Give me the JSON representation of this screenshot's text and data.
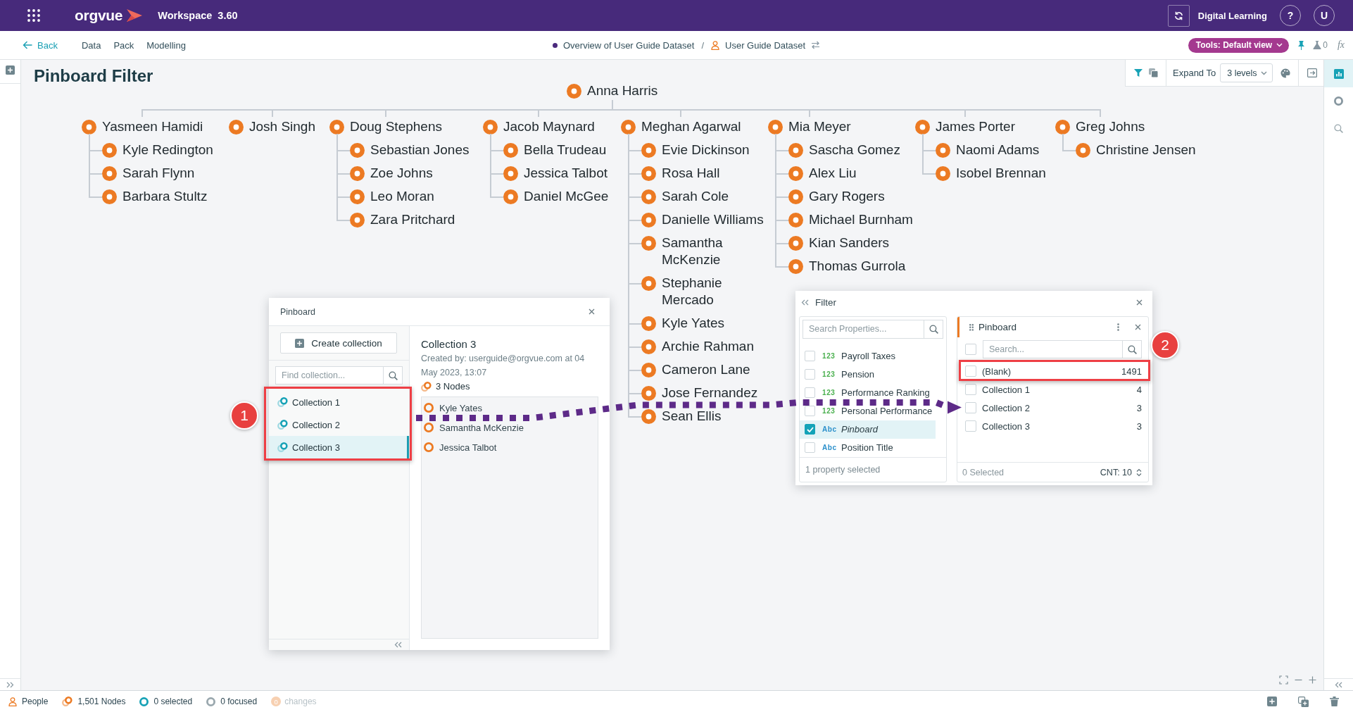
{
  "app_bar": {
    "logo": "orgvue",
    "product": "Workspace",
    "version": "3.60",
    "workspace_name": "Digital Learning",
    "help": "?",
    "avatar": "U"
  },
  "nav_bar": {
    "back": "Back",
    "menu": [
      "Data",
      "Pack",
      "Modelling"
    ],
    "breadcrumb": [
      {
        "kind": "view",
        "label": "Overview of User Guide Dataset"
      },
      {
        "kind": "separator",
        "label": "/"
      },
      {
        "kind": "dataset",
        "label": "User Guide Dataset"
      }
    ],
    "tools_button": "Tools: Default view",
    "flask_count": "0",
    "formula": "fx"
  },
  "page": {
    "title": "Pinboard Filter"
  },
  "toolbar": {
    "filter_active": true,
    "expand_label": "Expand To",
    "expand_value": "3 levels"
  },
  "side_tools": [
    {
      "selected": true
    },
    {
      "selected": false
    },
    {
      "selected": false
    }
  ],
  "tree": {
    "name": "Anna Harris",
    "children": [
      {
        "name": "Yasmeen Hamidi",
        "children": [
          {
            "name": "Kyle Redington"
          },
          {
            "name": "Sarah Flynn"
          },
          {
            "name": "Barbara Stultz"
          }
        ]
      },
      {
        "name": "Josh Singh"
      },
      {
        "name": "Doug Stephens",
        "children": [
          {
            "name": "Sebastian Jones"
          },
          {
            "name": "Zoe Johns"
          },
          {
            "name": "Leo Moran"
          },
          {
            "name": "Zara Pritchard"
          }
        ]
      },
      {
        "name": "Jacob Maynard",
        "children": [
          {
            "name": "Bella Trudeau"
          },
          {
            "name": "Jessica Talbot"
          },
          {
            "name": "Daniel McGee"
          }
        ]
      },
      {
        "name": "Meghan Agarwal",
        "children": [
          {
            "name": "Evie Dickinson"
          },
          {
            "name": "Rosa Hall"
          },
          {
            "name": "Sarah Cole"
          },
          {
            "name": "Danielle Williams"
          },
          {
            "name": "Samantha McKenzie"
          },
          {
            "name": "Stephanie Mercado"
          },
          {
            "name": "Kyle Yates"
          },
          {
            "name": "Archie Rahman"
          },
          {
            "name": "Cameron Lane"
          },
          {
            "name": "Jose Fernandez"
          },
          {
            "name": "Sean Ellis"
          }
        ]
      },
      {
        "name": "Mia Meyer",
        "children": [
          {
            "name": "Sascha Gomez"
          },
          {
            "name": "Alex Liu"
          },
          {
            "name": "Gary Rogers"
          },
          {
            "name": "Michael Burnham"
          },
          {
            "name": "Kian Sanders"
          },
          {
            "name": "Thomas Gurrola"
          }
        ]
      },
      {
        "name": "James Porter",
        "children": [
          {
            "name": "Naomi Adams"
          },
          {
            "name": "Isobel Brennan"
          }
        ]
      },
      {
        "name": "Greg Johns",
        "children": [
          {
            "name": "Christine Jensen"
          }
        ]
      }
    ]
  },
  "pinboard": {
    "title": "Pinboard",
    "create_button": "Create collection",
    "search": {
      "placeholder": "Find collection..."
    },
    "collections": [
      {
        "label": "Collection 1",
        "selected": false
      },
      {
        "label": "Collection 2",
        "selected": false
      },
      {
        "label": "Collection 3",
        "selected": true
      }
    ],
    "detail": {
      "title": "Collection 3",
      "created": "Created by: userguide@orgvue.com at 04 May 2023, 13:07",
      "node_count": "3 Nodes",
      "nodes": [
        "Kyle Yates",
        "Samantha McKenzie",
        "Jessica Talbot"
      ]
    }
  },
  "filter": {
    "title": "Filter",
    "properties": {
      "search": {
        "placeholder": "Search Properties..."
      },
      "items": [
        {
          "kind": "number",
          "type_label": "123",
          "name": "Payroll Taxes",
          "checked": false
        },
        {
          "kind": "number",
          "type_label": "123",
          "name": "Pension",
          "checked": false
        },
        {
          "kind": "number",
          "type_label": "123",
          "name": "Performance Ranking",
          "checked": false
        },
        {
          "kind": "number",
          "type_label": "123",
          "name": "Personal Performance",
          "checked": false
        },
        {
          "kind": "text",
          "type_label": "Abc",
          "name": "Pinboard",
          "checked": true
        },
        {
          "kind": "text",
          "type_label": "Abc",
          "name": "Position Title",
          "checked": false
        }
      ],
      "footer": "1 property selected"
    },
    "values_panel": {
      "title": "Pinboard",
      "select_all": {
        "checked": false
      },
      "search": {
        "placeholder": "Search..."
      },
      "values": [
        {
          "label": "(Blank)",
          "count": "1491",
          "checked": false
        },
        {
          "label": "Collection 1",
          "count": "4",
          "checked": false
        },
        {
          "label": "Collection 2",
          "count": "3",
          "checked": false
        },
        {
          "label": "Collection 3",
          "count": "3",
          "checked": false
        }
      ],
      "footer": "0 Selected",
      "count": "CNT: 10"
    }
  },
  "annotations": [
    {
      "kind": "callout",
      "label": "1"
    },
    {
      "kind": "callout",
      "label": "2"
    }
  ],
  "status_bar": {
    "entity": "People",
    "nodes": "1,501 Nodes",
    "selected": "0 selected",
    "focused": "0 focused",
    "changes": {
      "count": "0",
      "label": "changes",
      "disabled": true
    }
  }
}
